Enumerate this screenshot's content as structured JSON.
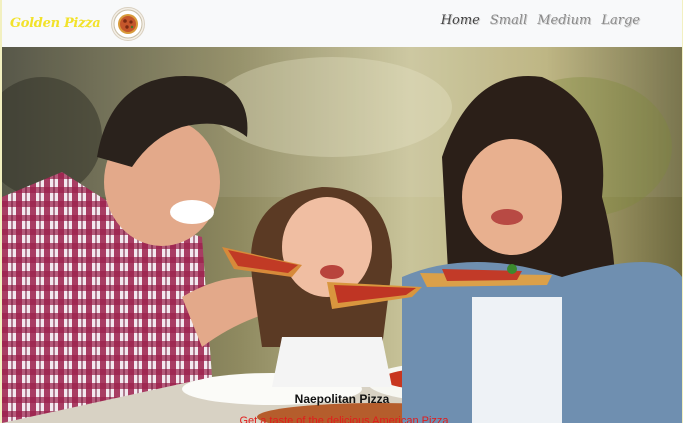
{
  "navbar": {
    "brand": "Golden Pizza",
    "logo_icon": "pizza-plate-icon",
    "links": [
      "Home",
      "Small",
      "Medium",
      "Large"
    ],
    "active_link": "Home"
  },
  "hero": {
    "image": "family-eating-pizza-photo",
    "caption_title": "Naepolitan Pizza",
    "caption_subtitle": "Get a taste of the delicious American Pizza"
  },
  "colors": {
    "brand": "#f2e22a",
    "subtitle": "#e21b1b",
    "navbar_bg": "#f8f9fa"
  }
}
